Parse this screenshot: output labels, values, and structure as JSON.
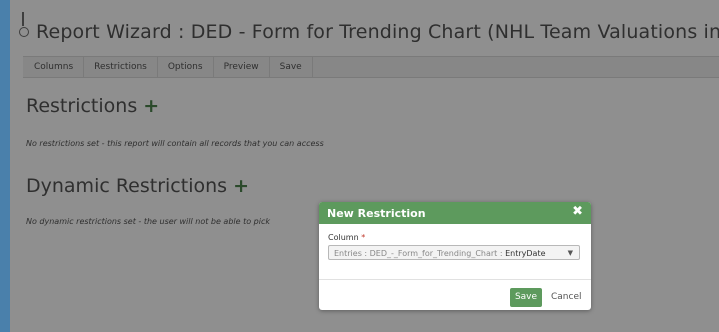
{
  "header": {
    "title": "Report Wizard : DED - Form for Trending Chart (NHL Team Valuations in mil USD)"
  },
  "tabs": [
    {
      "label": "Columns"
    },
    {
      "label": "Restrictions"
    },
    {
      "label": "Options"
    },
    {
      "label": "Preview"
    },
    {
      "label": "Save"
    }
  ],
  "restrictions": {
    "heading": "Restrictions",
    "add_icon": "+",
    "note": "No restrictions set - this report will contain all records that you can access"
  },
  "dynamic_restrictions": {
    "heading": "Dynamic Restrictions",
    "add_icon": "+",
    "note": "No dynamic restrictions set - the user will not be able to pick"
  },
  "modal": {
    "title": "New Restriction",
    "close_icon": "✖",
    "field_label": "Column",
    "required_marker": "*",
    "select_value_prefix": "Entries : DED_-_Form_for_Trending_Chart : ",
    "select_value_field": "EntryDate",
    "caret_icon": "▼",
    "save_label": "Save",
    "cancel_label": "Cancel"
  },
  "colors": {
    "accent_green": "#5d9a5d",
    "overlay_gray": "#8f8f8f",
    "frame_blue": "#4a80ab"
  }
}
